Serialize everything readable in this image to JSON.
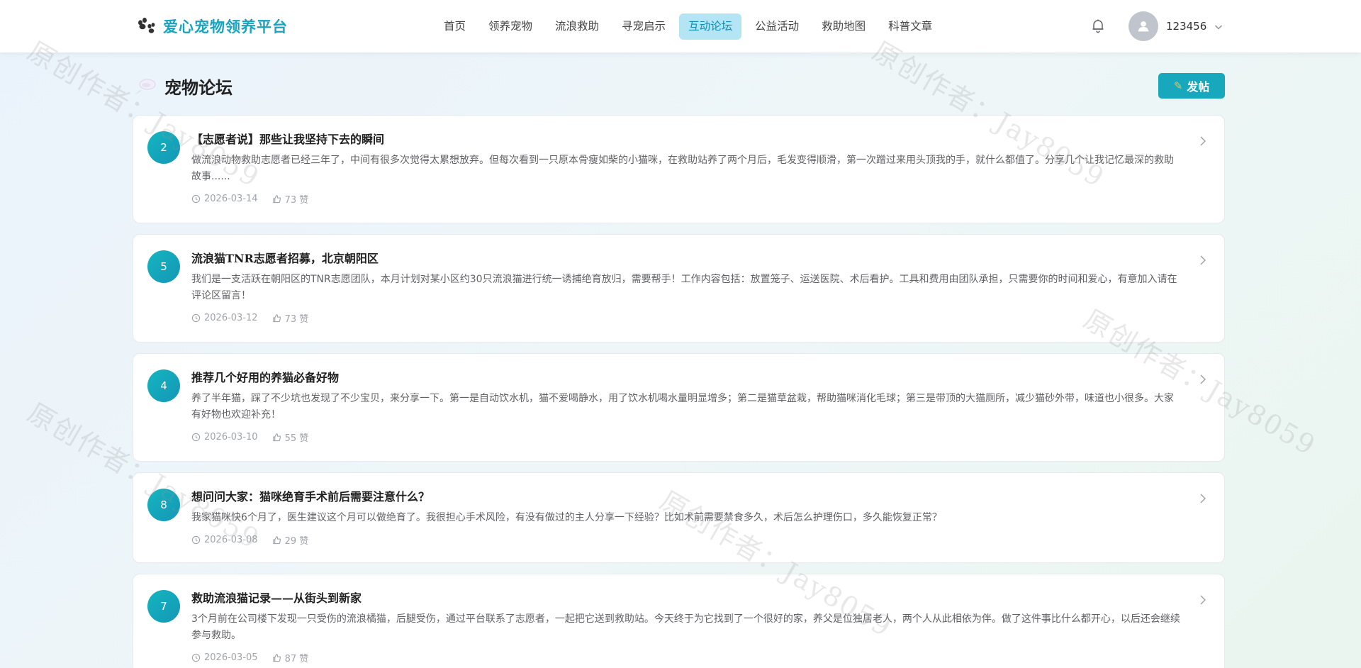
{
  "header": {
    "logo_text": "爱心宠物领养平台",
    "nav": [
      "首页",
      "领养宠物",
      "流浪救助",
      "寻宠启示",
      "互动论坛",
      "公益活动",
      "救助地图",
      "科普文章"
    ],
    "active_nav": "互动论坛",
    "username": "123456"
  },
  "watermark": "原创作者：Jay8059",
  "page": {
    "title": "宠物论坛",
    "post_button": "发帖"
  },
  "posts": [
    {
      "number": "2",
      "title": "【志愿者说】那些让我坚持下去的瞬间",
      "content": "做流浪动物救助志愿者已经三年了，中间有很多次觉得太累想放弃。但每次看到一只原本骨瘦如柴的小猫咪，在救助站养了两个月后，毛发变得顺滑，第一次蹭过来用头顶我的手，就什么都值了。分享几个让我记忆最深的救助故事......",
      "date": "2026-03-14",
      "likes": "73 赞"
    },
    {
      "number": "5",
      "title": "流浪猫TNR志愿者招募，北京朝阳区",
      "content": "我们是一支活跃在朝阳区的TNR志愿团队，本月计划对某小区约30只流浪猫进行统一诱捕绝育放归，需要帮手！工作内容包括：放置笼子、运送医院、术后看护。工具和费用由团队承担，只需要你的时间和爱心，有意加入请在评论区留言！",
      "date": "2026-03-12",
      "likes": "73 赞"
    },
    {
      "number": "4",
      "title": "推荐几个好用的养猫必备好物",
      "content": "养了半年猫，踩了不少坑也发现了不少宝贝，来分享一下。第一是自动饮水机，猫不爱喝静水，用了饮水机喝水量明显增多；第二是猫草盆栽，帮助猫咪消化毛球；第三是带顶的大猫厕所，减少猫砂外带，味道也小很多。大家有好物也欢迎补充！",
      "date": "2026-03-10",
      "likes": "55 赞"
    },
    {
      "number": "8",
      "title": "想问问大家：猫咪绝育手术前后需要注意什么？",
      "content": "我家猫咪快6个月了，医生建议这个月可以做绝育了。我很担心手术风险，有没有做过的主人分享一下经验？比如术前需要禁食多久，术后怎么护理伤口，多久能恢复正常？",
      "date": "2026-03-08",
      "likes": "29 赞"
    },
    {
      "number": "7",
      "title": "救助流浪猫记录——从街头到新家",
      "content": "3个月前在公司楼下发现一只受伤的流浪橘猫，后腿受伤，通过平台联系了志愿者，一起把它送到救助站。今天终于为它找到了一个很好的家，养父是位独居老人，两个人从此相依为伴。做了这件事比什么都开心，以后还会继续参与救助。",
      "date": "2026-03-05",
      "likes": "87 赞"
    }
  ]
}
